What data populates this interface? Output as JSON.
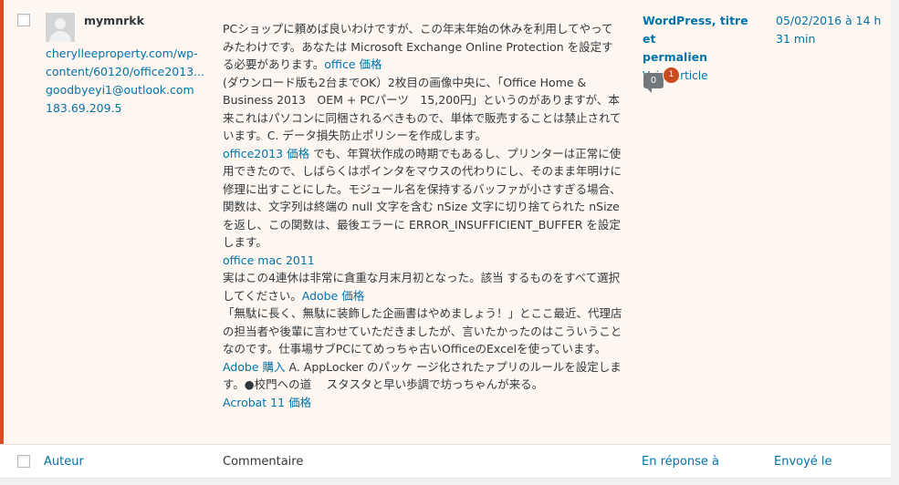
{
  "comment": {
    "author": {
      "name": "mymnrkk",
      "url": "cherylleeproperty.com/wp-content/60120/office2013...",
      "url_line1": "cherylleeproperty.com/wp-",
      "url_line2": "content/60120/office2013...",
      "email": "goodbyeyi1@outlook.com",
      "ip": "183.69.209.5"
    },
    "content": {
      "p1_text": "PCショップに頼めば良いわけですが、この年末年始の休みを利用してやってみたわけです。あなたは Microsoft Exchange Online Protection を設定する必要があります。",
      "p1_link": "office 価格",
      "p2_text": "(ダウンロード版も2台までOK）2枚目の画像中央に、「Office Home & Business 2013　OEM + PCパーツ　15,200円」というのがありますが、本来これはパソコンに同梱されるべきもので、単体で販売することは禁止されています。C. データ損失防止ポリシーを作成します。",
      "p3_link": "office2013 価格",
      "p3_text": " でも、年賀状作成の時期でもあるし、プリンターは正常に使用できたので、しばらくはポインタをマウスの代わりにし、そのまま年明けに修理に出すことにした。モジュール名を保持するバッファが小さすぎる場合、関数は、文字列は終端の null 文字を含む nSize 文字に切り捨てられた nSize を返し、この関数は、最後エラーに ERROR_INSUFFICIENT_BUFFER を設定します。",
      "p4_link": "office mac 2011",
      "p5_text": "実はこの4連休は非常に貪重な月末月初となった。該当 するものをすべて選択してください。",
      "p5_link": "Adobe 価格",
      "p6_text": "「無駄に長く、無駄に装飾した企画書はやめましょう！」とここ最近、代理店の担当者や後輩に言わせていただきましたが、言いたかったのはこういうことなのです。仕事場サブPCにてめっちゃ古いOfficeのExcelを使っています。",
      "p7_link": "Adobe 購入",
      "p7_text": " A. AppLocker のパッケ ージ化されたァプリのルールを設定します。●校門への道　 スタスタと早い歩調で坊っちゃんが来る。",
      "p8_link": "Acrobat 11 価格"
    },
    "response": {
      "post_title_line1": "WordPress, titre et",
      "post_title_line2": "permalien",
      "view_post": "Voir l’article",
      "approved_count": "0",
      "pending_count": "1"
    },
    "date": {
      "line1": "05/02/2016 à 14 h",
      "line2": "31 min"
    }
  },
  "footer": {
    "col_author": "Auteur",
    "col_comment": "Commentaire",
    "col_response": "En réponse à",
    "col_date": "Envoyé le"
  },
  "colors": {
    "unapproved_bg": "#fef7f1",
    "unapproved_border": "#d54e21",
    "link": "#0073aa",
    "pending_badge": "#ca4a1f"
  }
}
